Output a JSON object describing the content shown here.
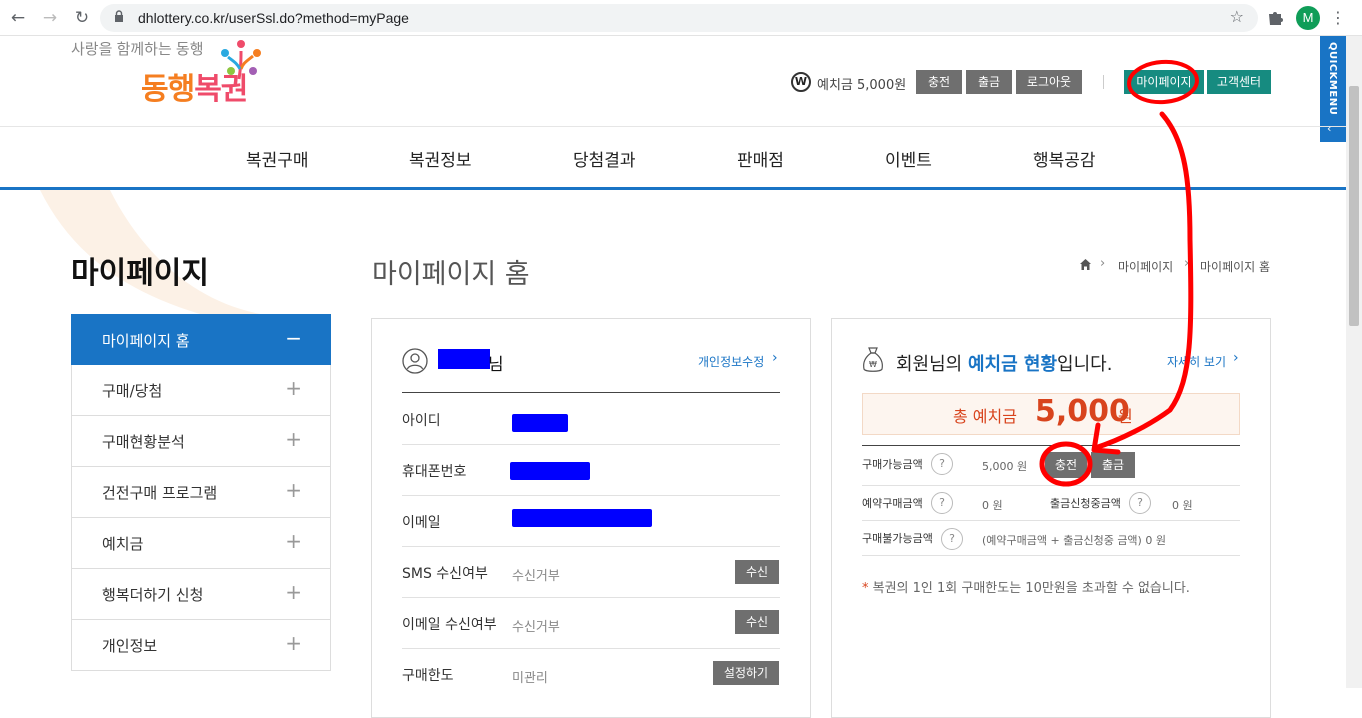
{
  "browser": {
    "url": "dhlottery.co.kr/userSsl.do?method=myPage",
    "profile_initial": "M"
  },
  "header": {
    "logo_tagline": "사랑을 함께하는 동행",
    "logo_part1": "동행",
    "logo_part2": "복권",
    "won_symbol": "W",
    "deposit_text": "예치금 5,000원",
    "btn_charge": "충전",
    "btn_withdraw": "출금",
    "btn_logout": "로그아웃",
    "btn_mypage": "마이페이지",
    "btn_customer": "고객센터",
    "quickmenu": "QUICKMENU"
  },
  "gnb": [
    "복권구매",
    "복권정보",
    "당첨결과",
    "판매점",
    "이벤트",
    "행복공감"
  ],
  "sidebar": {
    "title": "마이페이지",
    "items": [
      {
        "label": "마이페이지 홈",
        "sign": "−"
      },
      {
        "label": "구매/당첨",
        "sign": "+"
      },
      {
        "label": "구매현황분석",
        "sign": "+"
      },
      {
        "label": "건전구매 프로그램",
        "sign": "+"
      },
      {
        "label": "예치금",
        "sign": "+"
      },
      {
        "label": "행복더하기 신청",
        "sign": "+"
      },
      {
        "label": "개인정보",
        "sign": "+"
      }
    ]
  },
  "main": {
    "title": "마이페이지 홈",
    "breadcrumb": [
      "마이페이지",
      "마이페이지 홈"
    ]
  },
  "profile": {
    "nim": "님",
    "edit_link": "개인정보수정",
    "rows": {
      "id": "아이디",
      "phone": "휴대폰번호",
      "email": "이메일",
      "sms_label": "SMS 수신여부",
      "sms_value": "수신거부",
      "sms_btn": "수신",
      "email_rx_label": "이메일 수신여부",
      "email_rx_value": "수신거부",
      "email_rx_btn": "수신",
      "limit_label": "구매한도",
      "limit_value": "미관리",
      "limit_btn": "설정하기"
    }
  },
  "deposit": {
    "title_pre": "회원님의 ",
    "title_hl": "예치금 현황",
    "title_post": "입니다.",
    "detail_link": "자세히 보기",
    "total_label": "총 예치금",
    "total_value": "5,000",
    "total_unit": "원",
    "available_label": "구매가능금액",
    "available_value": "5,000 원",
    "charge_btn": "충전",
    "withdraw_btn": "출금",
    "reserved_label": "예약구매금액",
    "reserved_value": "0 원",
    "withdraw_req_label": "출금신청중금액",
    "withdraw_req_value": "0 원",
    "unavailable_label": "구매불가능금액",
    "unavailable_value": "(예약구매금액 + 출금신청중 금액)  0 원",
    "help": "?",
    "notice_star": "*",
    "notice": " 복권의 1인 1회 구매한도는 10만원을 초과할 수 없습니다."
  },
  "colors": {
    "brand_blue": "#1974c5",
    "teal": "#168b80",
    "accent_red": "#d8441d",
    "annotation_red": "#ff0000",
    "redaction_blue": "#0000ff"
  }
}
